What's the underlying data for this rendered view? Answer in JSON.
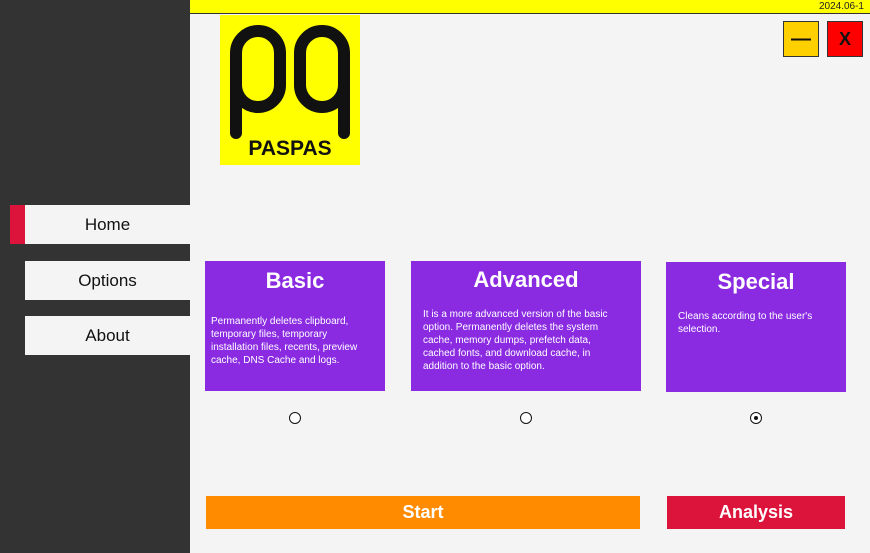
{
  "app": {
    "version": "2024.06-1",
    "logo_text": "PASPAS"
  },
  "window_controls": {
    "minimize_label": "—",
    "close_label": "X"
  },
  "nav": {
    "items": [
      {
        "label": "Home",
        "active": true
      },
      {
        "label": "Options",
        "active": false
      },
      {
        "label": "About",
        "active": false
      }
    ]
  },
  "cards": [
    {
      "title": "Basic",
      "description": "Permanently deletes clipboard, temporary files, temporary installation files, recents, preview cache, DNS Cache and logs.",
      "selected": false
    },
    {
      "title": "Advanced",
      "description": "It is a more advanced version of the basic option. Permanently deletes the system cache, memory dumps, prefetch  data, cached fonts, and download cache, in addition to the basic option.",
      "selected": false
    },
    {
      "title": "Special",
      "description": "Cleans according to the user's selection.",
      "selected": true
    }
  ],
  "actions": {
    "start_label": "Start",
    "analysis_label": "Analysis"
  },
  "colors": {
    "sidebar": "#333333",
    "accent_yellow": "#ffff00",
    "card_purple": "#8a2be2",
    "start_orange": "#ff8c00",
    "analysis_red": "#dc143c",
    "active_marker": "#dc143c"
  }
}
